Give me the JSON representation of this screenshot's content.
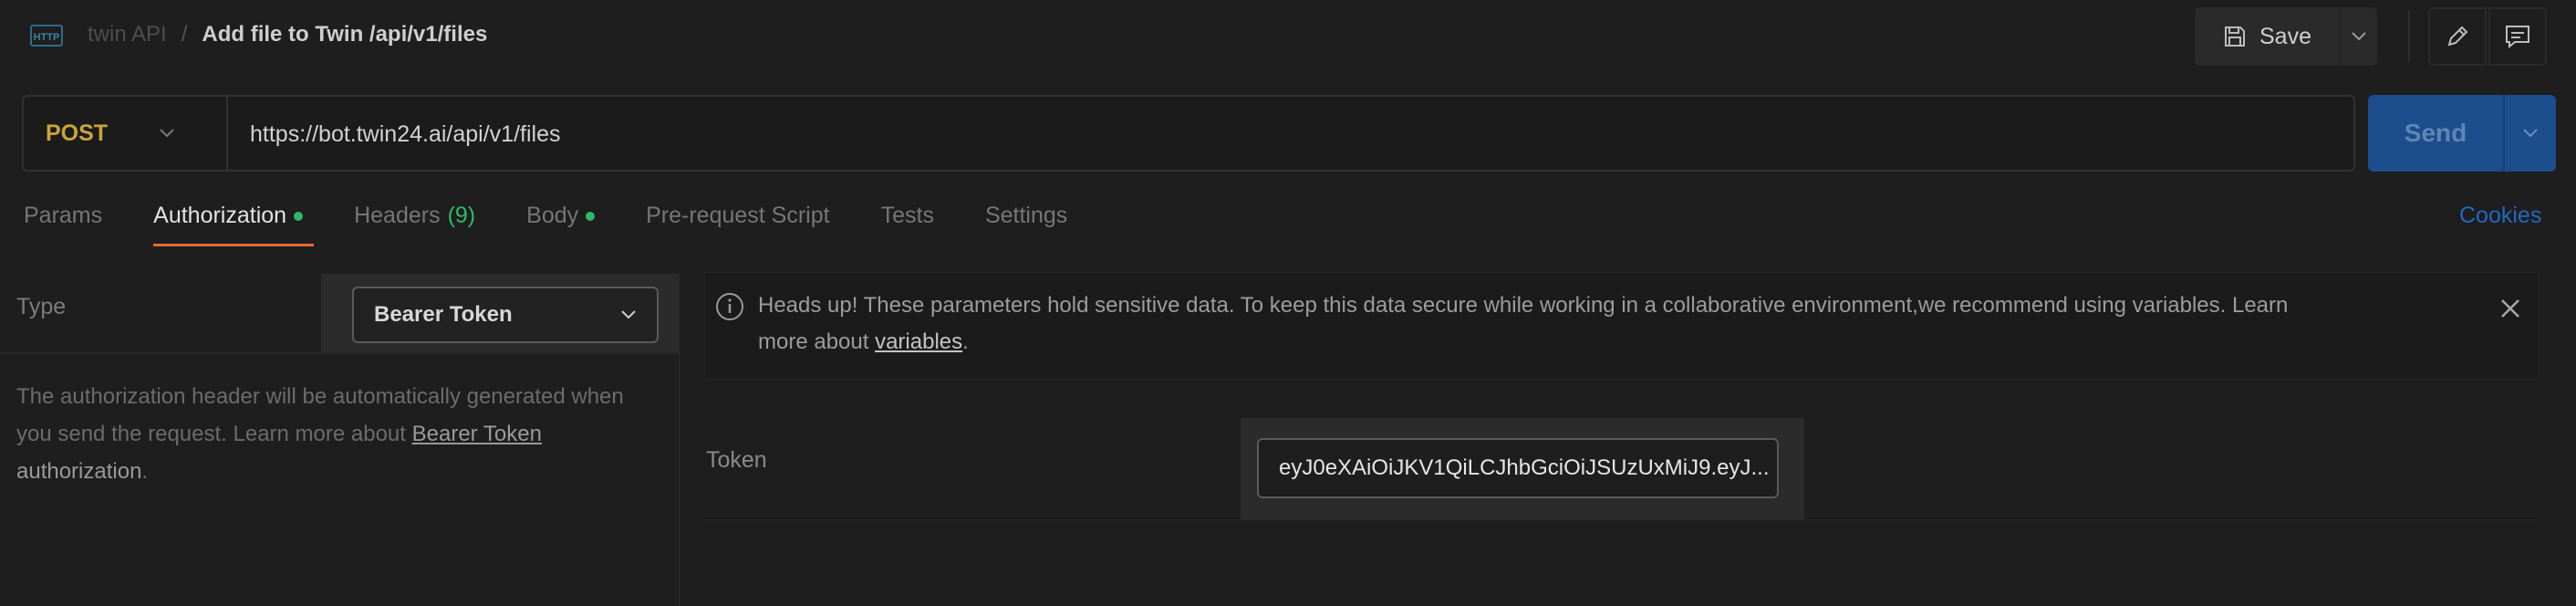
{
  "header": {
    "icon": "http-icon",
    "collection": "twin API",
    "separator": "/",
    "request_name": "Add file to Twin /api/v1/files",
    "save_label": "Save"
  },
  "request": {
    "method": "POST",
    "url": "https://bot.twin24.ai/api/v1/files",
    "send_label": "Send",
    "method_color": "#c9a53a",
    "send_color": "#1c4d8c"
  },
  "tabs": [
    {
      "label": "Params"
    },
    {
      "label": "Authorization",
      "dot": true,
      "active": true
    },
    {
      "label": "Headers",
      "count": "(9)"
    },
    {
      "label": "Body",
      "dot": true
    },
    {
      "label": "Pre-request Script"
    },
    {
      "label": "Tests"
    },
    {
      "label": "Settings"
    }
  ],
  "cookies_label": "Cookies",
  "auth": {
    "type_label": "Type",
    "type_value": "Bearer Token",
    "desc_pre": "The authorization header will be automatically generated when you send the request. Learn more about ",
    "desc_link": "Bearer Token",
    "desc_post": "authorization",
    "desc_end": "."
  },
  "alert": {
    "text": "Heads up! These parameters hold sensitive data. To keep this data secure while working in a collaborative environment,we recommend using variables. Learn more about ",
    "link": "variables",
    "end": "."
  },
  "token": {
    "label": "Token",
    "value": "eyJ0eXAiOiJKV1QiLCJhbGciOiJSUzUxMiJ9.eyJ..."
  },
  "colors": {
    "accent_tab": "#e86b33",
    "status_dot": "#2fb86a",
    "link_blue": "#2168c2"
  }
}
